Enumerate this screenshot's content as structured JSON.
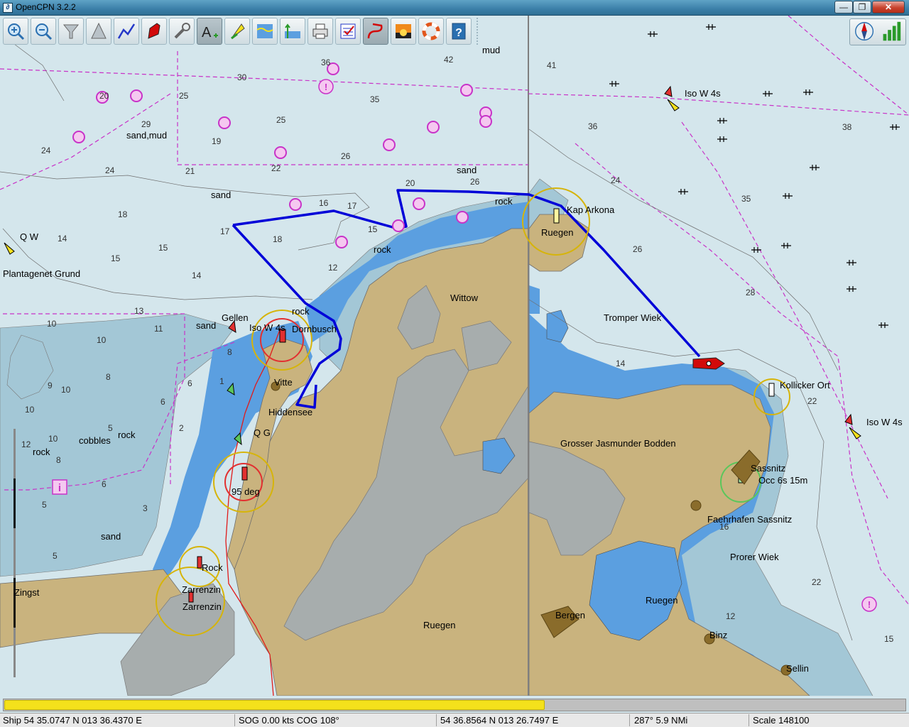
{
  "window": {
    "title": "OpenCPN 3.2.2",
    "controls": {
      "minimize": "—",
      "maximize": "❐",
      "close": "✕"
    }
  },
  "toolbar": {
    "buttons": [
      {
        "name": "zoom-in",
        "icon": "zoom-in-icon",
        "active": false
      },
      {
        "name": "zoom-out",
        "icon": "zoom-out-icon",
        "active": false
      },
      {
        "name": "scale-in",
        "icon": "funnel-icon",
        "active": false
      },
      {
        "name": "scale-out",
        "icon": "pyramid-icon",
        "active": false
      },
      {
        "name": "route",
        "icon": "route-icon",
        "active": false
      },
      {
        "name": "follow-ship",
        "icon": "ship-icon",
        "active": false
      },
      {
        "name": "settings",
        "icon": "wrench-icon",
        "active": false
      },
      {
        "name": "text",
        "icon": "text-icon",
        "active": true
      },
      {
        "name": "current-tide",
        "icon": "flag-icon",
        "active": false
      },
      {
        "name": "tides",
        "icon": "tide-icon",
        "active": false
      },
      {
        "name": "currents",
        "icon": "current-icon",
        "active": false
      },
      {
        "name": "print",
        "icon": "printer-icon",
        "active": false
      },
      {
        "name": "route-manager",
        "icon": "checklist-icon",
        "active": false
      },
      {
        "name": "track",
        "icon": "track-icon",
        "active": true
      },
      {
        "name": "color-scheme",
        "icon": "sunset-icon",
        "active": false
      },
      {
        "name": "mob",
        "icon": "lifebuoy-icon",
        "active": false
      },
      {
        "name": "help",
        "icon": "help-icon",
        "active": false
      }
    ]
  },
  "map": {
    "colors": {
      "sea_deep": "#d4e6ec",
      "sea_shallow": "#a3c7d6",
      "channel": "#5b9fe0",
      "land": "#c9b37e",
      "intertidal": "#a7adad",
      "route": "#0000d8",
      "magenta": "#c833c8"
    },
    "place_names": [
      "Kap Arkona",
      "Ruegen",
      "Wittow",
      "Tromper Wiek",
      "Grosser Jasmunder Bodden",
      "Kollicker Ort",
      "Sassnitz",
      "Occ 6s 15m",
      "Faehrhafen Sassnitz",
      "Prorer Wiek",
      "Bergen",
      "Ruegen",
      "Binz",
      "Sellin",
      "Ruegen",
      "Hiddensee",
      "Vitte",
      "Dornbusch",
      "Gellen",
      "Zingst",
      "Zarrenzin",
      "Zarrenzin",
      "Plantagenet Grund",
      "Iso W 4s",
      "Iso W 4s",
      "Iso W 4s",
      "Q W",
      "Q G",
      "95 deg",
      "Rock",
      "cobbles",
      "mud"
    ],
    "seabed_labels": [
      "sand,mud",
      "sand",
      "sand",
      "sand",
      "sand",
      "rock",
      "rock",
      "rock",
      "rock",
      "rock"
    ],
    "soundings": [
      "36",
      "42",
      "30",
      "35",
      "20",
      "25",
      "29",
      "25",
      "24",
      "19",
      "26",
      "21",
      "22",
      "24",
      "16",
      "17",
      "20",
      "26",
      "18",
      "17",
      "15",
      "15",
      "14",
      "15",
      "18",
      "12",
      "14",
      "13",
      "10",
      "11",
      "10",
      "9",
      "8",
      "6",
      "10",
      "6",
      "10",
      "5",
      "12",
      "10",
      "8",
      "6",
      "5",
      "3",
      "1",
      "2",
      "5",
      "8",
      "41",
      "36",
      "38",
      "24",
      "35",
      "26",
      "28",
      "14",
      "22",
      "16",
      "22",
      "12",
      "15"
    ]
  },
  "status": {
    "ship": "Ship 54 35.0747 N   013 36.4370 E",
    "sog": "SOG 0.00 kts   COG 108°",
    "cursor": "54 36.8564 N   013 26.7497 E",
    "brg": "287°   5.9 NMi",
    "scale": "Scale 148100"
  },
  "progress": {
    "value": 0.6
  }
}
